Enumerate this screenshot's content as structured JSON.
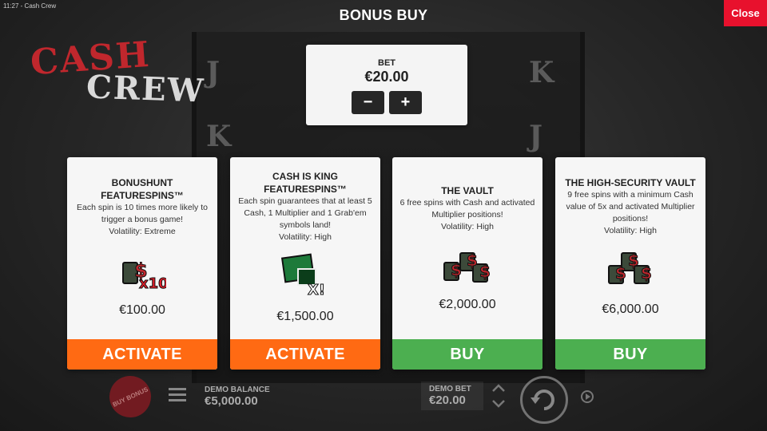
{
  "status_bar": "11:27 - Cash Crew",
  "logo": {
    "line1": "CASH",
    "line2": "CREW"
  },
  "header": {
    "title": "BONUS BUY",
    "close_label": "Close"
  },
  "bet": {
    "label": "BET",
    "value": "€20.00",
    "minus": "−",
    "plus": "+"
  },
  "cards": [
    {
      "title": "BONUSHUNT FEATURESPINS™",
      "description": "Each spin is 10 times more likely to trigger a bonus game!",
      "volatility": "Volatility: Extreme",
      "icon": "cash-x10-icon",
      "price": "€100.00",
      "action": "ACTIVATE",
      "action_color": "#ff6a13"
    },
    {
      "title": "CASH IS KING FEATURESPINS™",
      "description": "Each spin guarantees that at least 5 Cash, 1 Multiplier and 1 Grab'em symbols land!",
      "volatility": "Volatility: High",
      "icon": "cash-king-icon",
      "price": "€1,500.00",
      "action": "ACTIVATE",
      "action_color": "#ff6a13"
    },
    {
      "title": "THE VAULT",
      "description": "6 free spins with Cash and activated Multiplier positions!",
      "volatility": "Volatility: High",
      "icon": "vault-cash-icon",
      "price": "€2,000.00",
      "action": "BUY",
      "action_color": "#4caf50"
    },
    {
      "title": "THE HIGH-SECURITY VAULT",
      "description": "9 free spins with a minimum Cash value of 5x and activated Multiplier positions!",
      "volatility": "Volatility: High",
      "icon": "high-security-vault-icon",
      "price": "€6,000.00",
      "action": "BUY",
      "action_color": "#4caf50"
    }
  ],
  "footer": {
    "buy_bonus": "BUY BONUS",
    "demo_balance_label": "DEMO BALANCE",
    "demo_balance_value": "€5,000.00",
    "demo_bet_label": "DEMO BET",
    "demo_bet_value": "€20.00"
  }
}
